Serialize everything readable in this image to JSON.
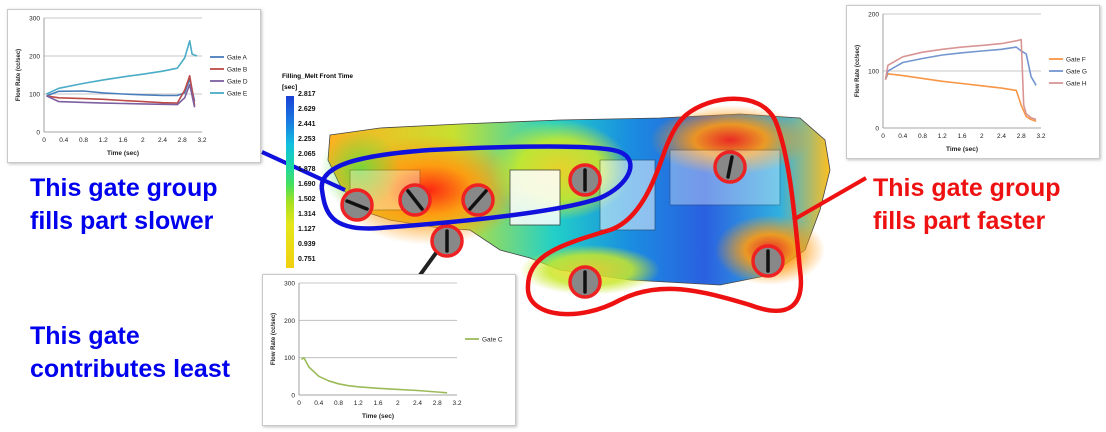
{
  "colors": {
    "blue_text": "#0000ee",
    "red_text": "#ee1111",
    "gate_marker": "#ee2222"
  },
  "captions": {
    "slow_group": [
      "This gate group",
      "fills part slower"
    ],
    "fast_group": [
      "This gate group",
      "fills part faster"
    ],
    "least_gate": [
      "This gate",
      "contributes least"
    ]
  },
  "legend": {
    "title": "Filling_Melt Front Time",
    "unit": "[sec]",
    "values": [
      "2.817",
      "2.629",
      "2.441",
      "2.253",
      "2.065",
      "1.878",
      "1.690",
      "1.502",
      "1.314",
      "1.127",
      "0.939",
      "0.751"
    ]
  },
  "part_image": {
    "icon": "dashboard-part-fill-contour"
  },
  "chart_data": [
    {
      "type": "line",
      "xlabel": "Time (sec)",
      "ylabel": "Flow Rate (cc/sec)",
      "xlim": [
        0,
        3.2
      ],
      "ylim": [
        0,
        300
      ],
      "xticks": [
        "0",
        "0.4",
        "0.8",
        "1.2",
        "1.6",
        "2",
        "2.4",
        "2.8",
        "3.2"
      ],
      "yticks": [
        "0",
        "100",
        "200",
        "300"
      ],
      "grid": "horizontal",
      "legend": "right",
      "series": [
        {
          "name": "Gate A",
          "color": "#4a7ebb",
          "x": [
            0.05,
            0.3,
            0.8,
            1.2,
            1.6,
            2.0,
            2.4,
            2.7,
            2.85,
            2.95,
            3.05
          ],
          "y": [
            95,
            107,
            108,
            103,
            100,
            98,
            96,
            96,
            103,
            140,
            80
          ]
        },
        {
          "name": "Gate B",
          "color": "#be4b48",
          "x": [
            0.05,
            0.3,
            0.8,
            1.2,
            1.6,
            2.0,
            2.4,
            2.7,
            2.85,
            2.95,
            3.05
          ],
          "y": [
            95,
            90,
            88,
            86,
            83,
            80,
            77,
            76,
            110,
            148,
            70
          ]
        },
        {
          "name": "Gate D",
          "color": "#7d60a0",
          "x": [
            0.05,
            0.3,
            0.8,
            1.2,
            1.6,
            2.0,
            2.4,
            2.7,
            2.85,
            2.95,
            3.05
          ],
          "y": [
            95,
            80,
            78,
            76,
            75,
            74,
            73,
            72,
            90,
            125,
            65
          ]
        },
        {
          "name": "Gate E",
          "color": "#4aacc6",
          "x": [
            0.05,
            0.3,
            0.8,
            1.2,
            1.6,
            2.0,
            2.4,
            2.7,
            2.85,
            2.95,
            3.0,
            3.1
          ],
          "y": [
            100,
            115,
            128,
            137,
            145,
            152,
            160,
            168,
            195,
            240,
            205,
            200
          ]
        }
      ]
    },
    {
      "type": "line",
      "xlabel": "Time (sec)",
      "ylabel": "Flow Rate (cc/sec)",
      "xlim": [
        0,
        3.2
      ],
      "ylim": [
        0,
        200
      ],
      "xticks": [
        "0",
        "0.4",
        "0.8",
        "1.2",
        "1.6",
        "2",
        "2.4",
        "2.8",
        "3.2"
      ],
      "yticks": [
        "0",
        "100",
        "200"
      ],
      "grid": "horizontal",
      "legend": "right",
      "series": [
        {
          "name": "Gate F",
          "color": "#f79646",
          "x": [
            0.05,
            0.1,
            0.4,
            0.8,
            1.2,
            1.6,
            2.0,
            2.4,
            2.7,
            2.8,
            2.9,
            3.0,
            3.1
          ],
          "y": [
            85,
            95,
            92,
            87,
            82,
            78,
            74,
            70,
            66,
            40,
            20,
            15,
            12
          ]
        },
        {
          "name": "Gate G",
          "color": "#7395d0",
          "x": [
            0.05,
            0.1,
            0.4,
            0.8,
            1.2,
            1.6,
            2.0,
            2.4,
            2.7,
            2.8,
            2.9,
            3.0,
            3.1
          ],
          "y": [
            85,
            100,
            115,
            122,
            128,
            132,
            135,
            138,
            142,
            135,
            130,
            90,
            75
          ]
        },
        {
          "name": "Gate H",
          "color": "#d99594",
          "x": [
            0.05,
            0.1,
            0.4,
            0.8,
            1.2,
            1.6,
            2.0,
            2.4,
            2.7,
            2.8,
            2.85,
            2.9,
            3.0,
            3.1
          ],
          "y": [
            85,
            110,
            125,
            133,
            138,
            142,
            145,
            148,
            153,
            155,
            40,
            25,
            18,
            15
          ]
        }
      ]
    },
    {
      "type": "line",
      "xlabel": "Time (sec)",
      "ylabel": "Flow Rate (cc/sec)",
      "xlim": [
        0,
        3.2
      ],
      "ylim": [
        0,
        300
      ],
      "xticks": [
        "0",
        "0.4",
        "0.8",
        "1.2",
        "1.6",
        "2",
        "2.4",
        "2.8",
        "3.2"
      ],
      "yticks": [
        "0",
        "100",
        "200",
        "300"
      ],
      "grid": "horizontal",
      "legend": "right",
      "series": [
        {
          "name": "Gate C",
          "color": "#9bbb59",
          "x": [
            0.05,
            0.1,
            0.2,
            0.4,
            0.6,
            0.8,
            1.0,
            1.2,
            1.6,
            2.0,
            2.4,
            2.8,
            3.0
          ],
          "y": [
            95,
            100,
            75,
            50,
            38,
            30,
            25,
            22,
            18,
            15,
            12,
            8,
            6
          ]
        }
      ]
    }
  ]
}
